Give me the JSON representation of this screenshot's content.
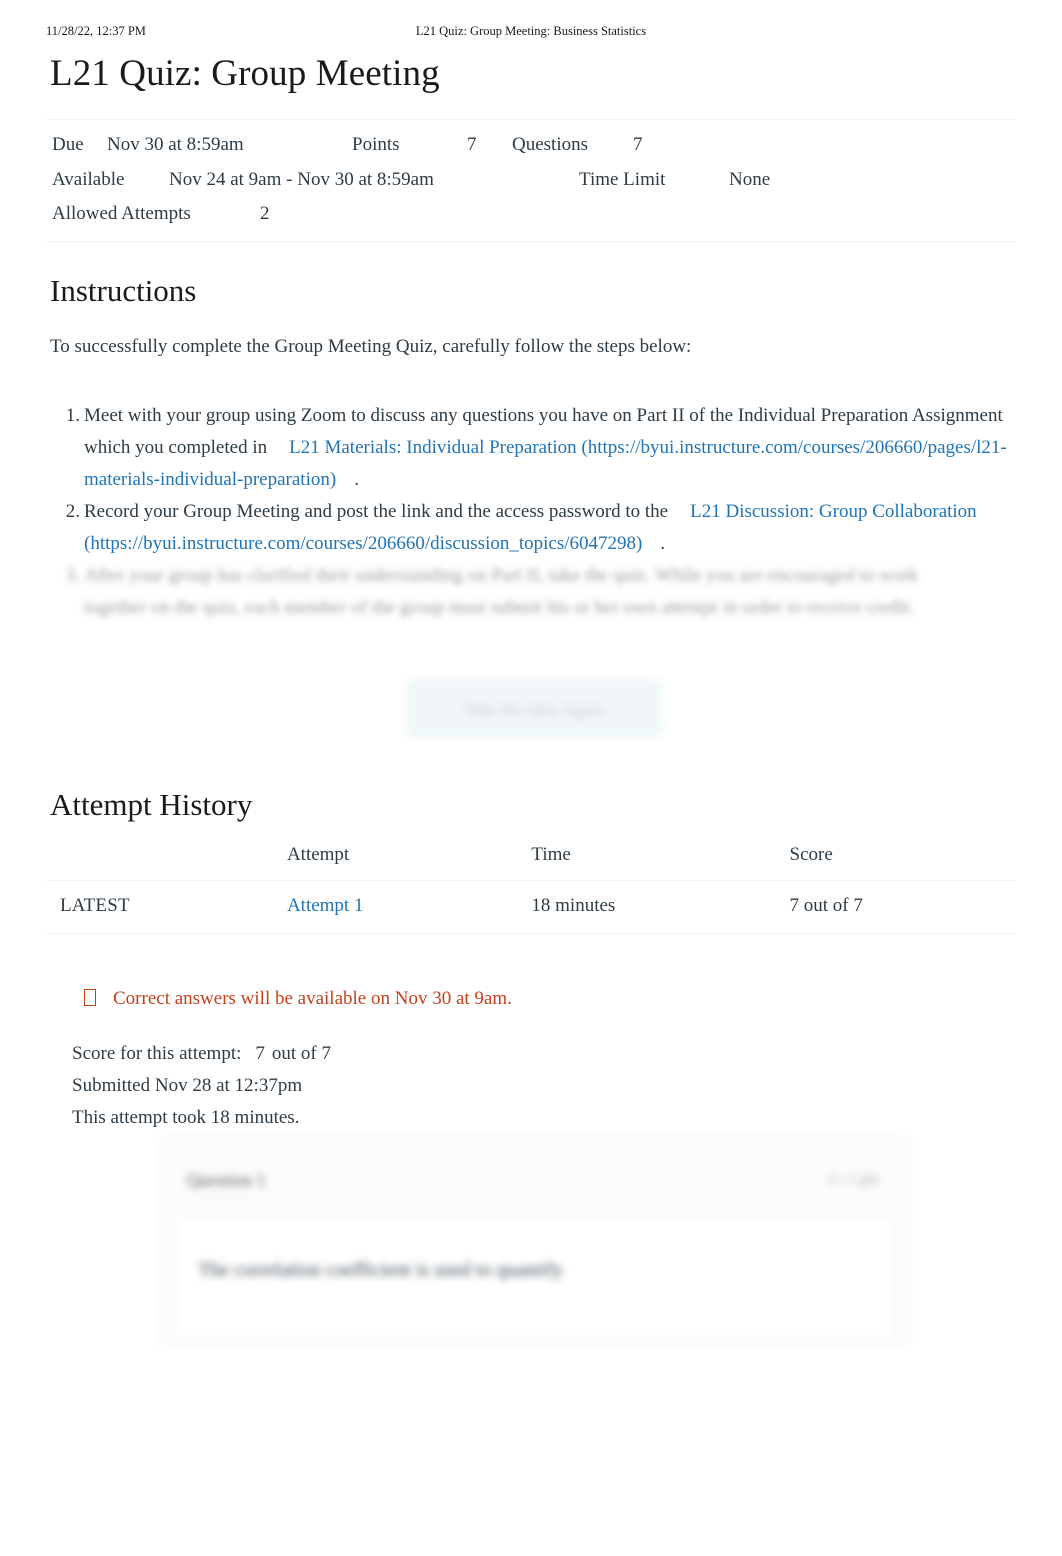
{
  "print_header": {
    "date": "11/28/22, 12:37 PM",
    "document_title": "L21 Quiz: Group Meeting: Business Statistics"
  },
  "page_title": "L21 Quiz: Group Meeting",
  "meta": {
    "due_label": "Due",
    "due_value": "Nov 30 at 8:59am",
    "points_label": "Points",
    "points_value": "7",
    "questions_label": "Questions",
    "questions_value": "7",
    "available_label": "Available",
    "available_value": "Nov 24 at 9am - Nov 30 at 8:59am",
    "time_limit_label": "Time Limit",
    "time_limit_value": "None",
    "allowed_attempts_label": "Allowed Attempts",
    "allowed_attempts_value": "2"
  },
  "instructions": {
    "heading": "Instructions",
    "intro": "To successfully complete the Group Meeting Quiz, carefully follow the steps below:",
    "steps": [
      {
        "number": "1.",
        "text_before": "Meet with your group using Zoom to discuss any questions you have on Part II of the Individual Preparation Assignment which you completed in",
        "link_text": "L21 Materials: Individual Preparation",
        "link_url": "(https://byui.instructure.com/courses/206660/pages/l21-materials-individual-preparation)",
        "text_after": "."
      },
      {
        "number": "2.",
        "text_before": "Record your Group Meeting and post the link and the access password to the",
        "link_text": "L21 Discussion: Group Collaboration",
        "link_url": "(https://byui.instructure.com/courses/206660/discussion_topics/6047298)",
        "text_after": "."
      },
      {
        "number": "3.",
        "text_before": "After your group has clarified their understanding on Part II, take the quiz. While you are encouraged to work together on the quiz, each member of the group must submit his or her own attempt in order to receive credit.",
        "link_text": "",
        "link_url": "",
        "text_after": ""
      }
    ]
  },
  "take_quiz_button": {
    "label": "Take the Quiz Again"
  },
  "attempt_history": {
    "heading": "Attempt History",
    "columns": [
      "",
      "Attempt",
      "Time",
      "Score"
    ],
    "rows": [
      {
        "kept": "LATEST",
        "attempt": "Attempt 1",
        "time": "18 minutes",
        "score": "7 out of 7"
      }
    ]
  },
  "answers_notice": {
    "icon": "info-box-icon",
    "text": "Correct answers will be available on Nov 30 at 9am."
  },
  "score_summary": {
    "score_label": "Score for this attempt:",
    "score_value": "7",
    "score_out_of": "out of 7",
    "submitted": "Submitted Nov 28 at 12:37pm",
    "duration": "This attempt took 18 minutes."
  },
  "question_card": {
    "name": "Question 1",
    "points": "1 / 1 pts",
    "text": "The correlation coefficient is used to quantify"
  },
  "colors": {
    "link": "#1f73b7",
    "notice": "#c4401a",
    "text": "#2d3b45",
    "rule": "#f3f4f5",
    "button_border": "#b9dbe0",
    "button_bg": "#f0f7f8"
  }
}
